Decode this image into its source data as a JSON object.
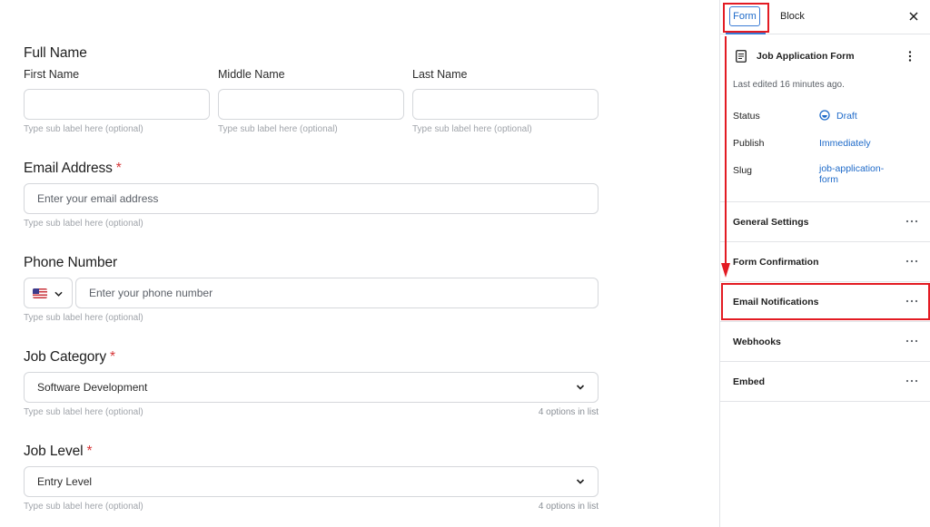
{
  "form": {
    "full_name": {
      "title": "Full Name",
      "first": {
        "label": "First Name",
        "hint": "Type sub label here (optional)"
      },
      "middle": {
        "label": "Middle Name",
        "hint": "Type sub label here (optional)"
      },
      "last": {
        "label": "Last Name",
        "hint": "Type sub label here (optional)"
      }
    },
    "email": {
      "title": "Email Address",
      "required_mark": "*",
      "placeholder": "Enter your email address",
      "hint": "Type sub label here (optional)"
    },
    "phone": {
      "title": "Phone Number",
      "placeholder": "Enter your phone number",
      "hint": "Type sub label here (optional)",
      "country_icon": "us-flag-icon"
    },
    "job_category": {
      "title": "Job Category",
      "required_mark": "*",
      "value": "Software Development",
      "hint": "Type sub label here (optional)",
      "options_count": "4 options in list"
    },
    "job_level": {
      "title": "Job Level",
      "required_mark": "*",
      "value": "Entry Level",
      "hint": "Type sub label here (optional)",
      "options_count": "4 options in list"
    }
  },
  "sidebar": {
    "tabs": {
      "form": "Form",
      "block": "Block"
    },
    "doc": {
      "title": "Job Application Form",
      "last_edited": "Last edited 16 minutes ago."
    },
    "meta": {
      "status_label": "Status",
      "status_value": "Draft",
      "publish_label": "Publish",
      "publish_value": "Immediately",
      "slug_label": "Slug",
      "slug_value_1": "job-application-",
      "slug_value_2": "form"
    },
    "panels": {
      "general": "General Settings",
      "confirmation": "Form Confirmation",
      "notifications": "Email Notifications",
      "webhooks": "Webhooks",
      "embed": "Embed"
    }
  },
  "colors": {
    "accent": "#1e6ac9",
    "annotation_red": "#e31b23",
    "required_red": "#d63638"
  }
}
